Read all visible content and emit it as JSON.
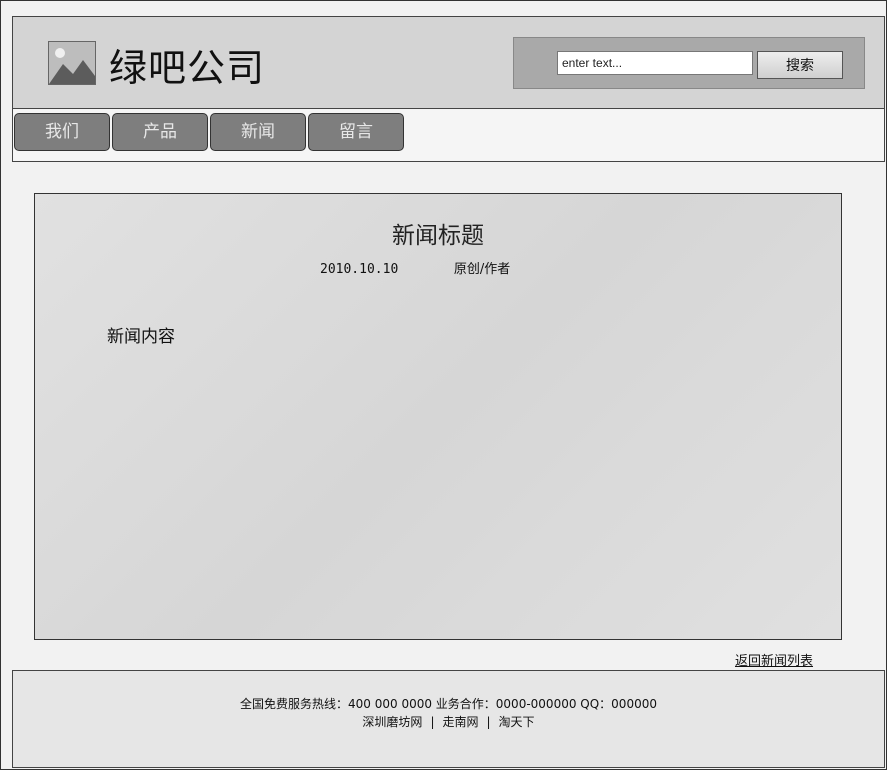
{
  "header": {
    "logo_icon": "image-placeholder-icon",
    "company_name": "绿吧公司",
    "search": {
      "placeholder": "enter text...",
      "button_label": "搜索"
    }
  },
  "nav": {
    "items": [
      {
        "label": "我们"
      },
      {
        "label": "产品"
      },
      {
        "label": "新闻"
      },
      {
        "label": "留言"
      }
    ]
  },
  "article": {
    "title": "新闻标题",
    "date": "2010.10.10",
    "source": "原创/作者",
    "content": "新闻内容"
  },
  "back_link": "返回新闻列表",
  "footer": {
    "hotline_text": "全国免费服务热线：400 000 0000 业务合作：0000-000000 QQ：000000",
    "links": [
      "深圳磨坊网",
      "走南网",
      "淘天下"
    ],
    "separator": "|"
  },
  "colors": {
    "header_bg": "#d4d4d4",
    "search_bg": "#a9a9a9",
    "nav_button_bg": "#7e7e7e",
    "article_bg": "#dcdcdc",
    "footer_bg": "#e6e6e6"
  }
}
